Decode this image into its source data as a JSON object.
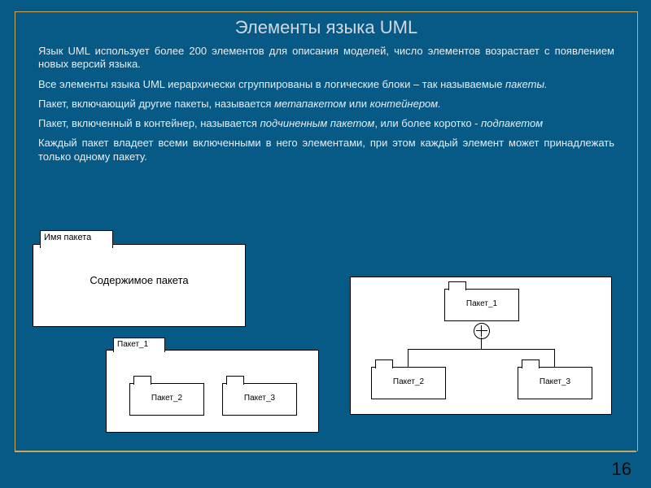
{
  "title": "Элементы языка UML",
  "paragraphs": {
    "p1": "Язык UML использует более 200 элементов для описания моделей, число элементов возрастает с появлением новых версий языка.",
    "p2a": "Все элементы языка UML иерархически сгруппированы в логические блоки – так называемые ",
    "p2b": "пакеты.",
    "p3a": "Пакет, включающий другие пакеты, называется ",
    "p3b": "метапакетом",
    "p3c": " или ",
    "p3d": "контейнером.",
    "p4a": "Пакет, включенный в контейнер, называется ",
    "p4b": "подчиненным пакетом",
    "p4c": ", или более коротко - ",
    "p4d": "подпакетом",
    "p5": "Каждый пакет владеет всеми включенными в него элементами, при этом каждый элемент может принадлежать только одному пакету."
  },
  "diagram1": {
    "tab": "Имя пакета",
    "body": "Содержимое пакета"
  },
  "diagram2": {
    "tab": "Пакет_1",
    "pkg2": "Пакет_2",
    "pkg3": "Пакет_3"
  },
  "diagram3": {
    "pkg1": "Пакет_1",
    "pkg2": "Пакет_2",
    "pkg3": "Пакет_3"
  },
  "page_number": "16"
}
